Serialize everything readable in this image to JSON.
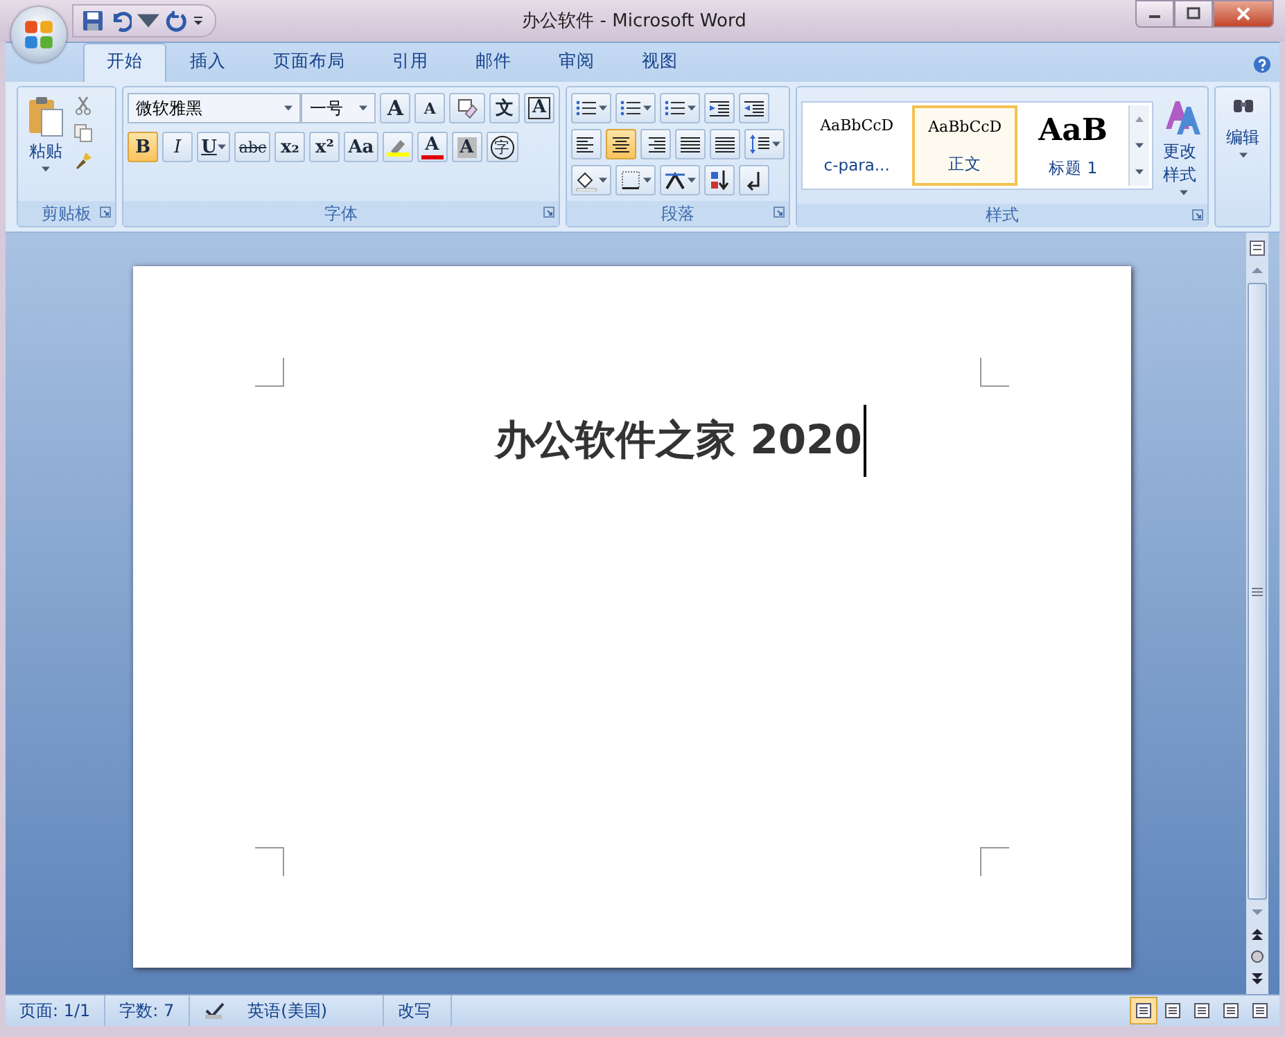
{
  "window": {
    "title": "办公软件 - Microsoft Word"
  },
  "tabs": [
    {
      "label": "开始",
      "selected": true
    },
    {
      "label": "插入",
      "selected": false
    },
    {
      "label": "页面布局",
      "selected": false
    },
    {
      "label": "引用",
      "selected": false
    },
    {
      "label": "邮件",
      "selected": false
    },
    {
      "label": "审阅",
      "selected": false
    },
    {
      "label": "视图",
      "selected": false
    }
  ],
  "clipboard": {
    "paste_label": "粘贴",
    "title": "剪贴板"
  },
  "font": {
    "font_name": "微软雅黑",
    "font_size": "一号",
    "title": "字体",
    "row1": [
      {
        "kind": "grow",
        "text": "A"
      },
      {
        "kind": "shrink",
        "text": "A"
      },
      {
        "kind": "eraser"
      },
      {
        "kind": "glyph",
        "text": "文"
      },
      {
        "kind": "boxed",
        "text": "A"
      }
    ],
    "row2": [
      {
        "kind": "glyph",
        "text": "B",
        "selected": true
      },
      {
        "kind": "italic",
        "text": "I",
        "selected": false
      },
      {
        "kind": "underline",
        "text": "U",
        "selected": false
      },
      {
        "kind": "strike",
        "text": "abc",
        "selected": false
      },
      {
        "kind": "glyph",
        "text": "x₂",
        "selected": false
      },
      {
        "kind": "glyph",
        "text": "x²",
        "selected": false
      },
      {
        "kind": "glyph",
        "text": "Aa",
        "selected": false
      }
    ],
    "font_color_letter": "A",
    "shading_letter": "A",
    "enclose_char": "字"
  },
  "paragraph": {
    "title": "段落",
    "alignments": [
      {
        "selected": false
      },
      {
        "selected": true
      },
      {
        "selected": false
      },
      {
        "selected": false
      },
      {
        "selected": false
      }
    ]
  },
  "styles": {
    "title": "样式",
    "change_label": "更改样式",
    "items": [
      {
        "sample": "AaBbCcD",
        "label": "c-para...",
        "kind": "small",
        "selected": false
      },
      {
        "sample": "AaBbCcD",
        "label": "正文",
        "kind": "small",
        "selected": true
      },
      {
        "sample": "AaB",
        "label": "标题 1",
        "kind": "large",
        "selected": false
      }
    ]
  },
  "editing": {
    "label": "编辑"
  },
  "document": {
    "text": "办公软件之家 2020"
  },
  "status": {
    "items": [
      "页面: 1/1",
      "字数: 7",
      "英语(美国)",
      "改写"
    ],
    "views": [
      {
        "selected": true
      },
      {
        "selected": false
      },
      {
        "selected": false
      },
      {
        "selected": false
      },
      {
        "selected": false
      }
    ]
  }
}
